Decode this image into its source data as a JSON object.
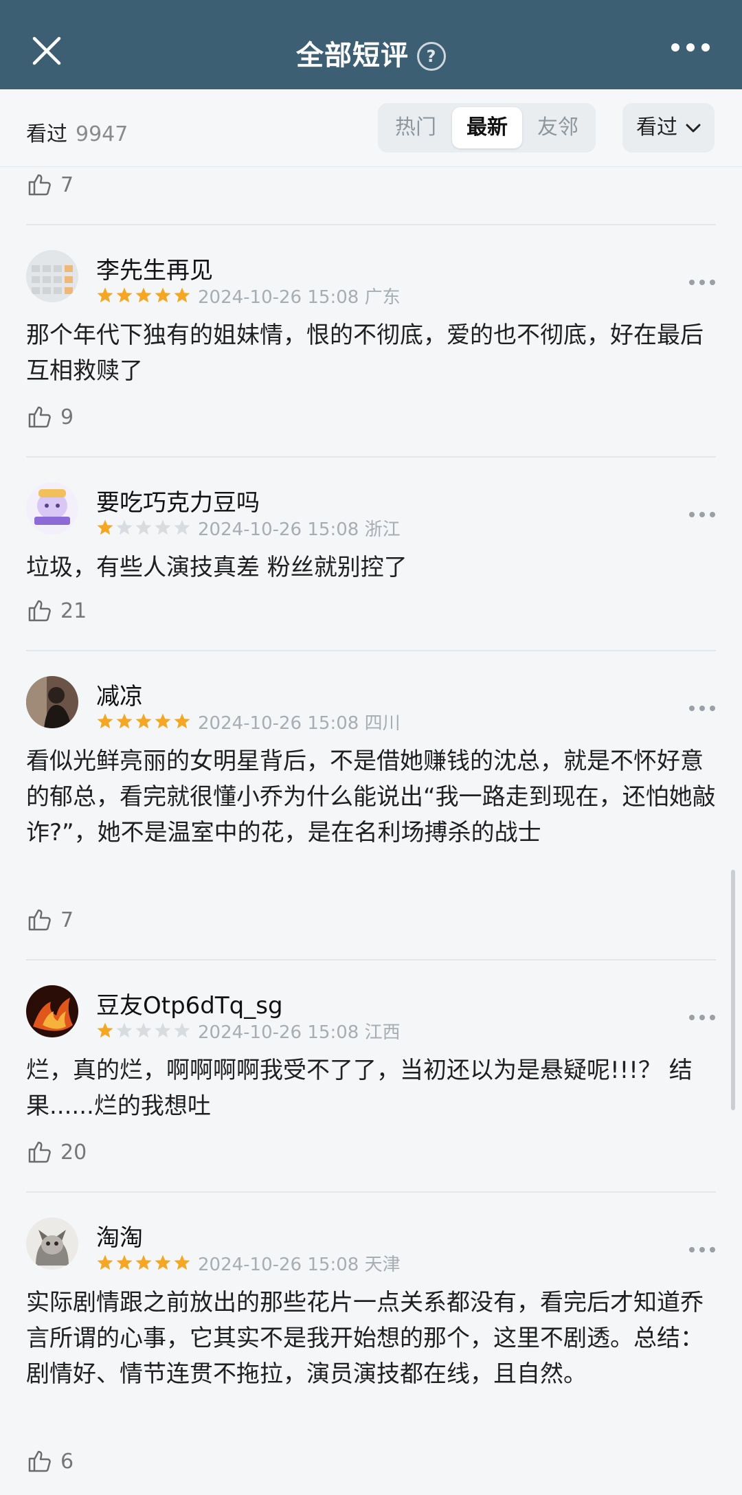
{
  "header": {
    "title": "全部短评",
    "help_glyph": "?",
    "close_icon": "close-icon",
    "more_icon": "more-horizontal-icon"
  },
  "subbar": {
    "watched_label": "看过",
    "watched_count": "9947",
    "tabs": [
      {
        "label": "热门",
        "active": false
      },
      {
        "label": "最新",
        "active": true
      },
      {
        "label": "友邻",
        "active": false
      }
    ],
    "filter_label": "看过"
  },
  "top_like": {
    "count": "7"
  },
  "colors": {
    "header_bg": "#3d5f73",
    "star_on": "#f5a623",
    "star_off": "#d9dcdf"
  },
  "reviews": [
    {
      "user": "李先生再见",
      "rating": 5,
      "date": "2024-10-26 15:08",
      "location": "广东",
      "text": "那个年代下独有的姐妹情，恨的不彻底，爱的也不彻底，好在最后互相救赎了",
      "likes": "9"
    },
    {
      "user": "要吃巧克力豆吗",
      "rating": 1,
      "date": "2024-10-26 15:08",
      "location": "浙江",
      "text": "垃圾，有些人演技真差 粉丝就别控了",
      "likes": "21"
    },
    {
      "user": "减凉",
      "rating": 5,
      "date": "2024-10-26 15:08",
      "location": "四川",
      "text": "看似光鲜亮丽的女明星背后，不是借她赚钱的沈总，就是不怀好意的郁总，看完就很懂小乔为什么能说出“我一路走到现在，还怕她敲诈?”，她不是温室中的花，是在名利场搏杀的战士",
      "likes": "7"
    },
    {
      "user": "豆友Otp6dTq_sg",
      "rating": 1,
      "date": "2024-10-26 15:08",
      "location": "江西",
      "text": "烂，真的烂，啊啊啊啊我受不了了，当初还以为是悬疑呢!!!？ 结果......烂的我想吐",
      "likes": "20"
    },
    {
      "user": "淘淘",
      "rating": 5,
      "date": "2024-10-26 15:08",
      "location": "天津",
      "text": "实际剧情跟之前放出的那些花片一点关系都没有，看完后才知道乔言所谓的心事，它其实不是我开始想的那个，这里不剧透。总结：剧情好、情节连贯不拖拉，演员演技都在线，且自然。",
      "likes": "6"
    }
  ]
}
